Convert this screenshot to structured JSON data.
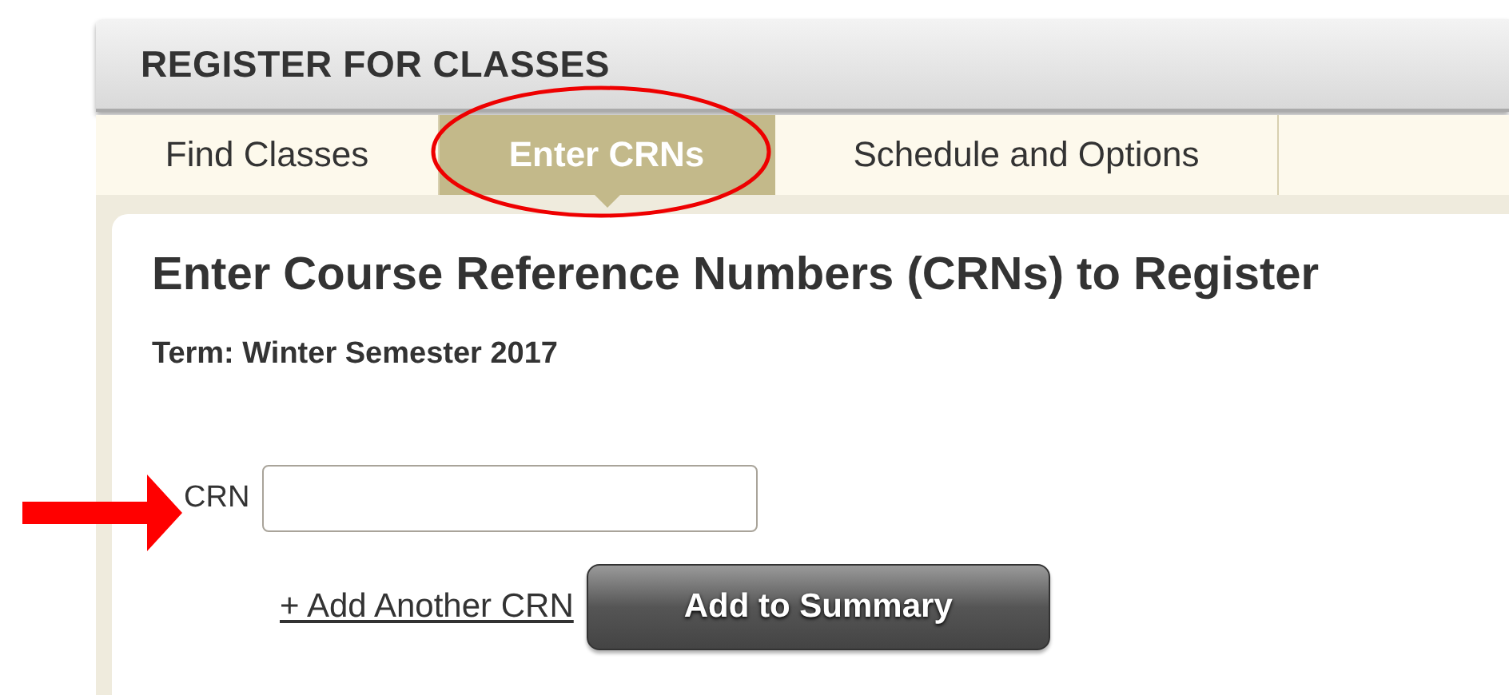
{
  "panel": {
    "title": "REGISTER FOR CLASSES"
  },
  "tabs": [
    {
      "label": "Find Classes",
      "selected": false
    },
    {
      "label": "Enter CRNs",
      "selected": true
    },
    {
      "label": "Schedule and Options",
      "selected": false
    }
  ],
  "content": {
    "heading": "Enter Course Reference Numbers (CRNs) to Register",
    "term": "Term: Winter Semester 2017",
    "crn_label": "CRN",
    "add_link": "+ Add Another CRN",
    "submit_button": "Add to Summary"
  }
}
